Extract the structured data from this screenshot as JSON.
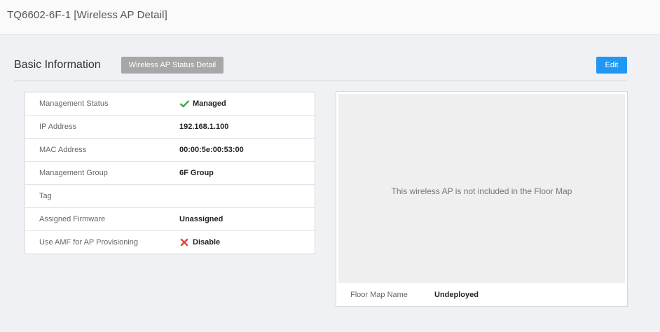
{
  "header": {
    "title": "TQ6602-6F-1 [Wireless AP Detail]"
  },
  "section": {
    "title": "Basic Information",
    "status_detail_label": "Wireless AP Status Detail",
    "edit_label": "Edit"
  },
  "info_rows": [
    {
      "label": "Management Status",
      "value": "Managed",
      "icon": "check-icon"
    },
    {
      "label": "IP Address",
      "value": "192.168.1.100"
    },
    {
      "label": "MAC Address",
      "value": "00:00:5e:00:53:00"
    },
    {
      "label": "Management Group",
      "value": "6F Group"
    },
    {
      "label": "Tag",
      "value": ""
    },
    {
      "label": "Assigned Firmware",
      "value": "Unassigned"
    },
    {
      "label": "Use AMF for AP Provisioning",
      "value": "Disable",
      "icon": "cross-icon"
    }
  ],
  "floor_map": {
    "message": "This wireless AP is not included in the Floor Map",
    "name_label": "Floor Map Name",
    "name_value": "Undeployed"
  },
  "colors": {
    "accent": "#2196f3",
    "check": "#3aa845",
    "cross": "#e8473b",
    "secondary_button": "#a7a7a7"
  }
}
